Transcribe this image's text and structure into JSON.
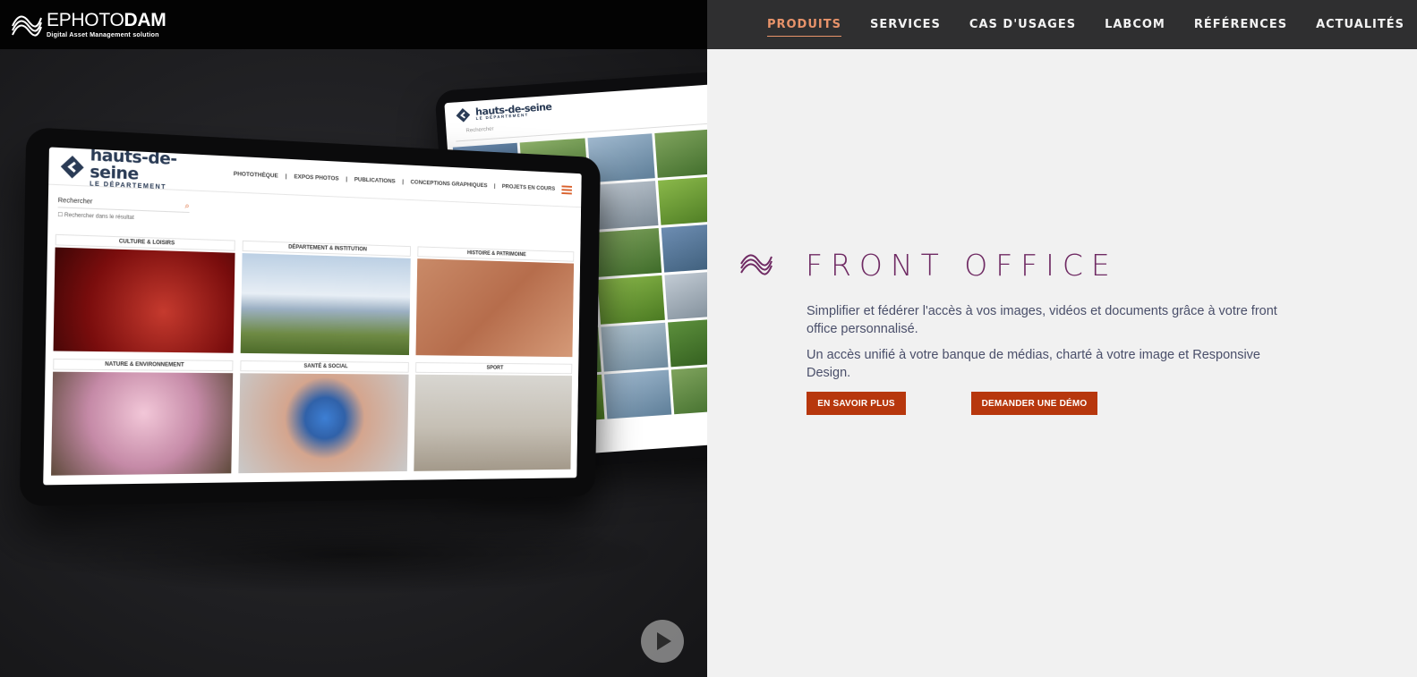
{
  "logo": {
    "word_light": "EPHOTO",
    "word_bold": "DAM",
    "tagline": "Digital Asset Management solution"
  },
  "nav": {
    "items": [
      {
        "label": "PRODUITS",
        "active": true
      },
      {
        "label": "SERVICES",
        "active": false
      },
      {
        "label": "CAS D'USAGES",
        "active": false
      },
      {
        "label": "LABCOM",
        "active": false
      },
      {
        "label": "RÉFÉRENCES",
        "active": false
      },
      {
        "label": "ACTUALITÉS",
        "active": false
      }
    ]
  },
  "hero": {
    "tablet": {
      "brand": "hauts-de-seine",
      "brand_sub": "LE DÉPARTEMENT",
      "menu": [
        "PHOTOTHÈQUE",
        "|",
        "EXPOS PHOTOS",
        "|",
        "PUBLICATIONS",
        "|",
        "CONCEPTIONS GRAPHIQUES",
        "|",
        "PROJETS EN COURS"
      ],
      "search_placeholder": "Rechercher",
      "search_check": "Rechercher dans le résultat",
      "categories": [
        "CULTURE & LOISIRS",
        "DÉPARTEMENT & INSTITUTION",
        "HISTOIRE & PATRIMOINE",
        "NATURE & ENVIRONNEMENT",
        "SANTÉ & SOCIAL",
        "SPORT"
      ]
    },
    "back_tablet": {
      "brand": "hauts-de-seine",
      "brand_sub": "LE DÉPARTEMENT",
      "search_placeholder": "Rechercher"
    },
    "play_icon": "play-icon"
  },
  "content": {
    "icon": "ephotodam-waves-icon",
    "title": "FRONT OFFICE",
    "paragraph_1": "Simplifier et fédérer l'accès à vos images, vidéos et documents grâce à votre front office personnalisé.",
    "paragraph_2": "Un accès unifié à votre banque de médias, charté à votre image et Responsive Design.",
    "button_more": "EN SAVOIR PLUS",
    "button_demo": "DEMANDER UNE DÉMO"
  },
  "colors": {
    "accent_orange": "#e8936a",
    "title_purple": "#6f2a63",
    "button_red": "#b7370d",
    "text_blue_grey": "#4a4f6a"
  }
}
